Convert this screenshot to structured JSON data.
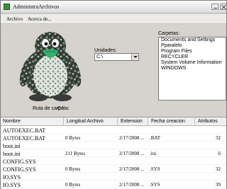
{
  "window": {
    "title": "AdministraArchivos"
  },
  "menu": {
    "items": [
      "Archivo",
      "Acerca de..."
    ]
  },
  "unidades": {
    "label": "Unidades:",
    "selected": "C:\\"
  },
  "carpetas": {
    "label": "Carpetas:",
    "items": [
      "Documents and Settings",
      "Pparalelo",
      "Program Files",
      "RECYCLER",
      "System Volume Information",
      "WINDOWS"
    ]
  },
  "ruta": {
    "label": "Ruta de carpeta:",
    "value": "C:\\"
  },
  "grid": {
    "headers": [
      "Nombre",
      "Longitud Archivo",
      "Extension",
      "Fecha creacion",
      "Atributos"
    ],
    "rows": [
      {
        "name": "AUTOEXEC.BAT",
        "size": "",
        "date": "",
        "ext": "",
        "attr": ""
      },
      {
        "name": "AUTOEXEC.BAT",
        "size": "0 Bytes",
        "date": "2/17/2008 ...",
        "ext": ".BAT",
        "attr": "32"
      },
      {
        "name": "boot.ini",
        "size": "",
        "date": "",
        "ext": "",
        "attr": ""
      },
      {
        "name": "boot.ini",
        "size": "211 Bytes",
        "date": "2/17/2008 ...",
        "ext": ".ini",
        "attr": "6"
      },
      {
        "name": "CONFIG.SYS",
        "size": "",
        "date": "",
        "ext": "",
        "attr": ""
      },
      {
        "name": "CONFIG.SYS",
        "size": "0 Bytes",
        "date": "2/17/2008 ...",
        "ext": ".SYS",
        "attr": "32"
      },
      {
        "name": "IO.SYS",
        "size": "",
        "date": "",
        "ext": "",
        "attr": ""
      },
      {
        "name": "IO.SYS",
        "size": "0 Bytes",
        "date": "2/17/2008 ...",
        "ext": ".SYS",
        "attr": "39"
      }
    ]
  }
}
